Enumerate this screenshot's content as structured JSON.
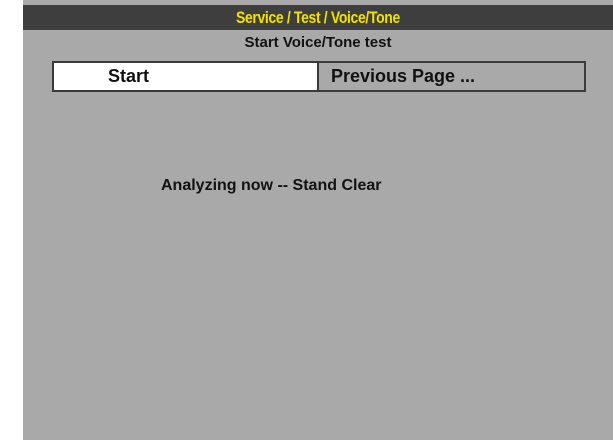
{
  "header": {
    "title": "Service / Test / Voice/Tone",
    "subtitle": "Start Voice/Tone test"
  },
  "buttons": {
    "start_label": "Start",
    "previous_label": "Previous Page ..."
  },
  "status": {
    "message": "Analyzing now -- Stand Clear"
  },
  "colors": {
    "background": "#a9a9a9",
    "title_bar": "#3e3e3e",
    "title_text": "#f2e200",
    "selected_button": "#ffffff"
  }
}
